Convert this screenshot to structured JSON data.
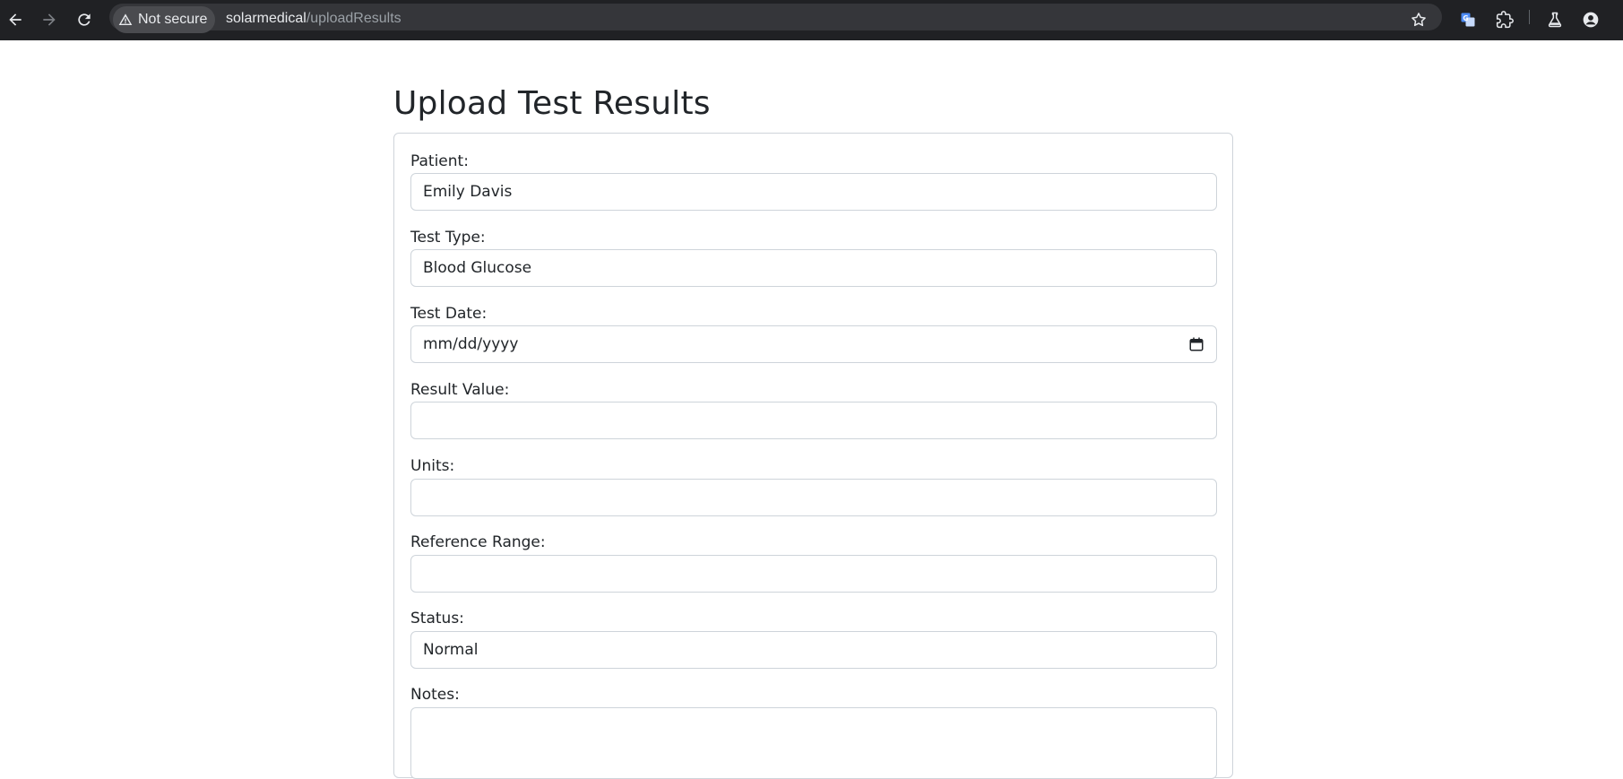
{
  "browser": {
    "security_label": "Not secure",
    "url_host": "solarmedical",
    "url_path": "/uploadResults"
  },
  "page": {
    "title": "Upload Test Results"
  },
  "form": {
    "patient": {
      "label": "Patient:",
      "value": "Emily Davis"
    },
    "test_type": {
      "label": "Test Type:",
      "value": "Blood Glucose"
    },
    "test_date": {
      "label": "Test Date:",
      "value": "mm/dd/yyyy"
    },
    "result_value": {
      "label": "Result Value:",
      "value": ""
    },
    "units": {
      "label": "Units:",
      "value": ""
    },
    "reference_range": {
      "label": "Reference Range:",
      "value": ""
    },
    "status": {
      "label": "Status:",
      "value": "Normal"
    },
    "notes": {
      "label": "Notes:",
      "value": ""
    }
  },
  "icons": {
    "back": "arrow-left-icon",
    "forward": "arrow-right-icon",
    "reload": "reload-icon",
    "warning": "warning-triangle-icon",
    "bookmark": "star-icon",
    "translate": "translate-icon",
    "extensions": "puzzle-icon",
    "labs": "flask-icon",
    "profile": "account-icon",
    "calendar": "calendar-icon"
  },
  "colors": {
    "chrome_bg": "#202124",
    "omnibox_bg": "#35363a",
    "text": "#212529",
    "border": "#ced4da",
    "translate_blue": "#4c8bf5"
  }
}
